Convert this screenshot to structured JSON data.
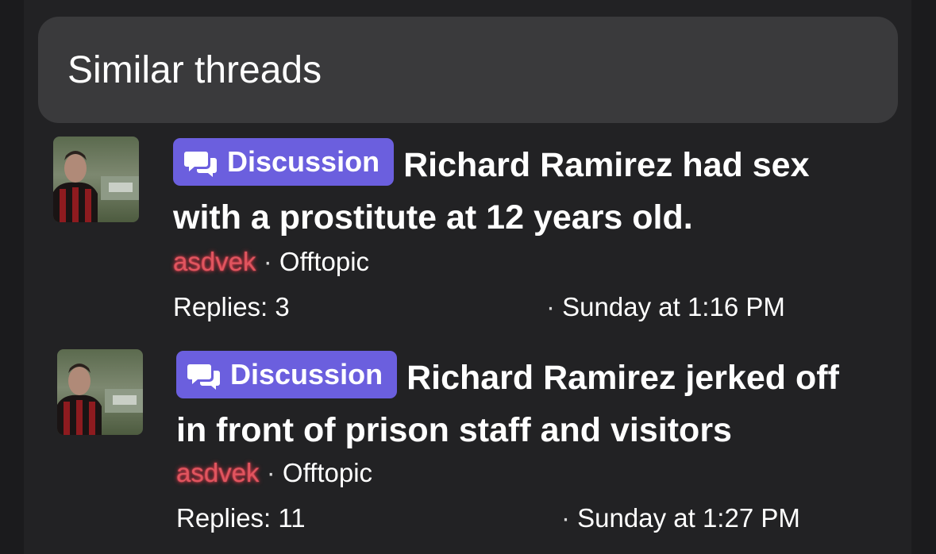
{
  "section": {
    "title": "Similar threads"
  },
  "threads": [
    {
      "prefix": "Discussion",
      "title": "Richard Ramirez had sex with a prostitute at 12 years old.",
      "author": "asdvek",
      "forum": "Offtopic",
      "replies": "Replies: 3",
      "date": "Sunday at 1:16 PM"
    },
    {
      "prefix": "Discussion",
      "title": "Richard Ramirez jerked off in front of prison staff and visitors",
      "author": "asdvek",
      "forum": "Offtopic",
      "replies": "Replies: 11",
      "date": "Sunday at 1:27 PM"
    }
  ],
  "colors": {
    "background": "#1b1b1d",
    "panel": "#222224",
    "header": "#3a3a3c",
    "badge": "#6b5fde",
    "author": "#e0555f"
  },
  "icons": {
    "badge_icon": "chat-bubbles-icon",
    "avatar": "user-avatar-photo"
  }
}
